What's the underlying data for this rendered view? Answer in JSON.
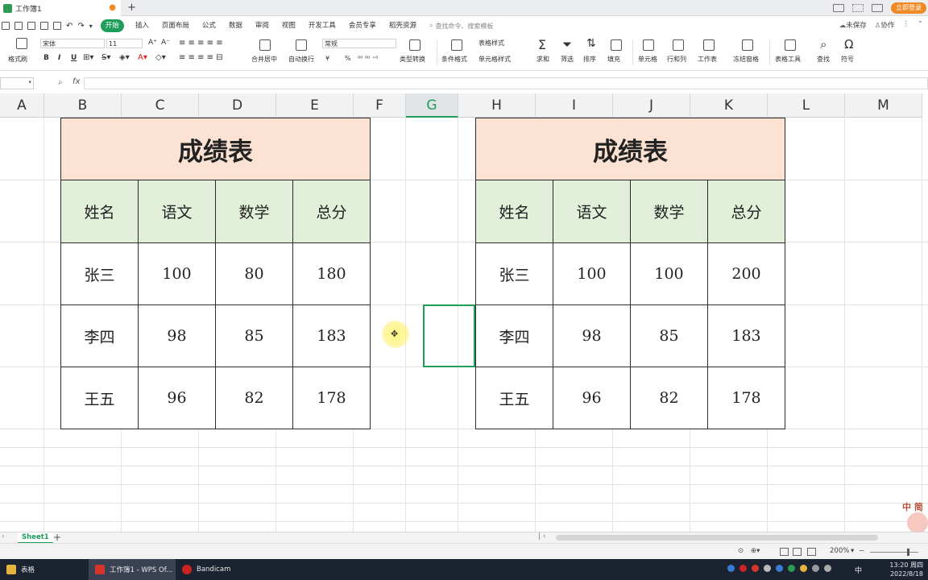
{
  "titlebar": {
    "doc_tab": "工作簿1",
    "new_tab": "+",
    "login_button": "立即登录"
  },
  "menubar": {
    "items": [
      "开始",
      "插入",
      "页面布局",
      "公式",
      "数据",
      "审阅",
      "视图",
      "开发工具",
      "会员专享",
      "稻壳资源"
    ],
    "command_search": "查找命令、搜索模板",
    "unsaved": "未保存",
    "collaborate": "协作"
  },
  "ribbon": {
    "format_painter": "格式刷",
    "font_name": "宋体",
    "font_size": "11",
    "bold": "B",
    "italic": "I",
    "underline": "U",
    "merge_center": "合并居中",
    "wrap_text": "自动换行",
    "number_format": "常规",
    "currency": "¥",
    "percent": "%",
    "type_convert": "类型转换",
    "cond_format": "条件格式",
    "table_style": "表格样式",
    "cell_style": "单元格样式",
    "sum": "求和",
    "filter": "筛选",
    "sort": "排序",
    "fill": "填充",
    "cell": "单元格",
    "rows_cols": "行和列",
    "worksheet": "工作表",
    "freeze": "冻结窗格",
    "table_tools": "表格工具",
    "find": "查找",
    "symbol": "符号"
  },
  "formula_bar": {
    "fx": "fx",
    "value": ""
  },
  "columns": [
    "A",
    "B",
    "C",
    "D",
    "E",
    "F",
    "G",
    "H",
    "I",
    "J",
    "K",
    "L",
    "M"
  ],
  "selected_column": "G",
  "left_table": {
    "title": "成绩表",
    "headers": [
      "姓名",
      "语文",
      "数学",
      "总分"
    ],
    "rows": [
      [
        "张三",
        "100",
        "80",
        "180"
      ],
      [
        "李四",
        "98",
        "85",
        "183"
      ],
      [
        "王五",
        "96",
        "82",
        "178"
      ]
    ]
  },
  "right_table": {
    "title": "成绩表",
    "headers": [
      "姓名",
      "语文",
      "数学",
      "总分"
    ],
    "rows": [
      [
        "张三",
        "100",
        "100",
        "200"
      ],
      [
        "李四",
        "98",
        "85",
        "183"
      ],
      [
        "王五",
        "96",
        "82",
        "178"
      ]
    ]
  },
  "sheetbar": {
    "sheet_name": "Sheet1",
    "add_sheet": "+"
  },
  "statusbar": {
    "zoom": "200%"
  },
  "taskbar": {
    "tasks": [
      "表格",
      "工作簿1 - WPS Of...",
      "Bandicam"
    ],
    "ime": "中",
    "time": "13:20 周四",
    "date": "2022/8/18"
  },
  "watermark": "中 简",
  "colors": {
    "accent": "#1e9e5a",
    "title_fill": "#fbe2d3",
    "header_fill": "#e2efd9",
    "selection": "#1e9e5a"
  }
}
